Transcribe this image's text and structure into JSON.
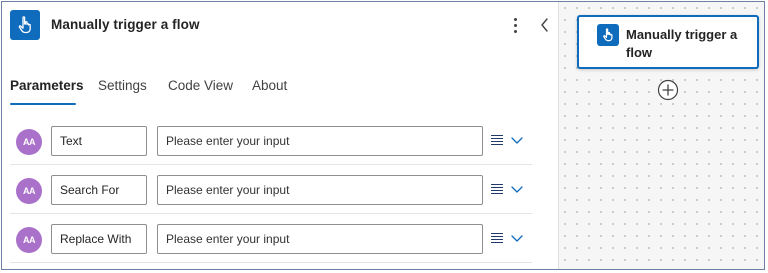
{
  "panel": {
    "title": "Manually trigger a flow",
    "icon": "hand-pointer-icon"
  },
  "tabs": [
    {
      "label": "Parameters",
      "active": true
    },
    {
      "label": "Settings",
      "active": false
    },
    {
      "label": "Code View",
      "active": false
    },
    {
      "label": "About",
      "active": false
    }
  ],
  "params": [
    {
      "avatar": "AA",
      "name": "Text",
      "placeholder": "Please enter your input"
    },
    {
      "avatar": "AA",
      "name": "Search For",
      "placeholder": "Please enter your input"
    },
    {
      "avatar": "AA",
      "name": "Replace With",
      "placeholder": "Please enter your input"
    }
  ],
  "canvas": {
    "node_title": "Manually trigger a flow"
  },
  "colors": {
    "accent": "#0f6cbd",
    "avatar": "#a971c9"
  }
}
